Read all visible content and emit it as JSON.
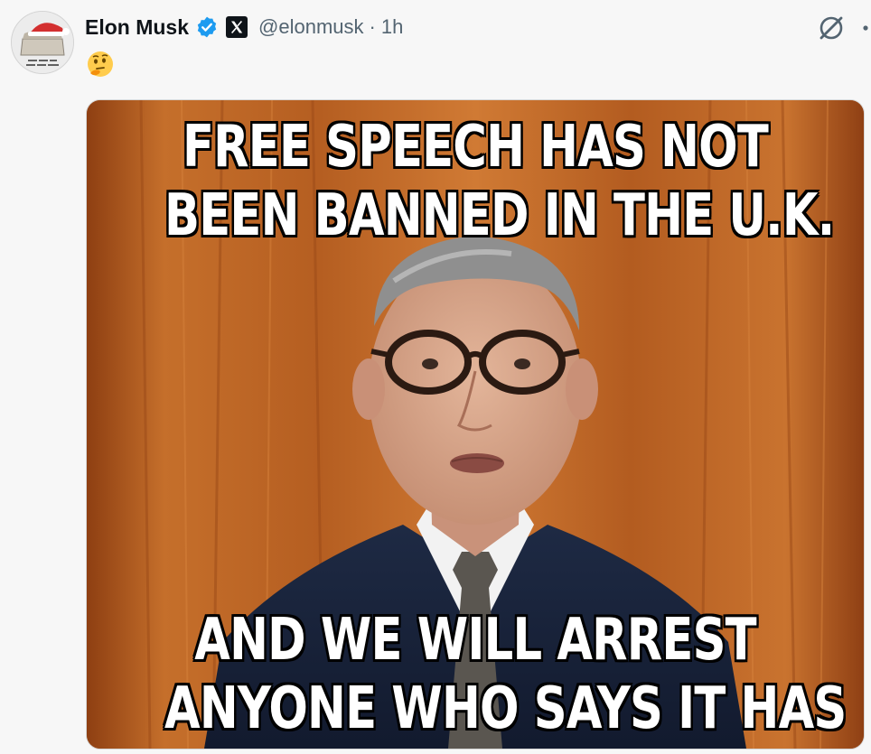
{
  "post": {
    "author": {
      "display_name": "Elon Musk",
      "handle": "@elonmusk",
      "separator": "·",
      "time": "1h",
      "verified_icon": "verified-badge-icon",
      "affiliation_icon": "x-logo-icon",
      "avatar_icon": "avatar-santa-hat"
    },
    "text_emoji": "🤔",
    "actions": {
      "grok_icon": "grok-icon",
      "more_icon": "more-dots-icon"
    },
    "media": {
      "caption_top": [
        "FREE SPEECH HAS NOT",
        "BEEN BANNED IN THE U.K."
      ],
      "caption_bottom": [
        "AND WE WILL ARREST",
        "ANYONE WHO SAYS IT HAS"
      ]
    }
  },
  "colors": {
    "verified_blue": "#1d9bf0",
    "text_primary": "#0f1419",
    "text_secondary": "#536471",
    "background": "#f7f7f7"
  }
}
